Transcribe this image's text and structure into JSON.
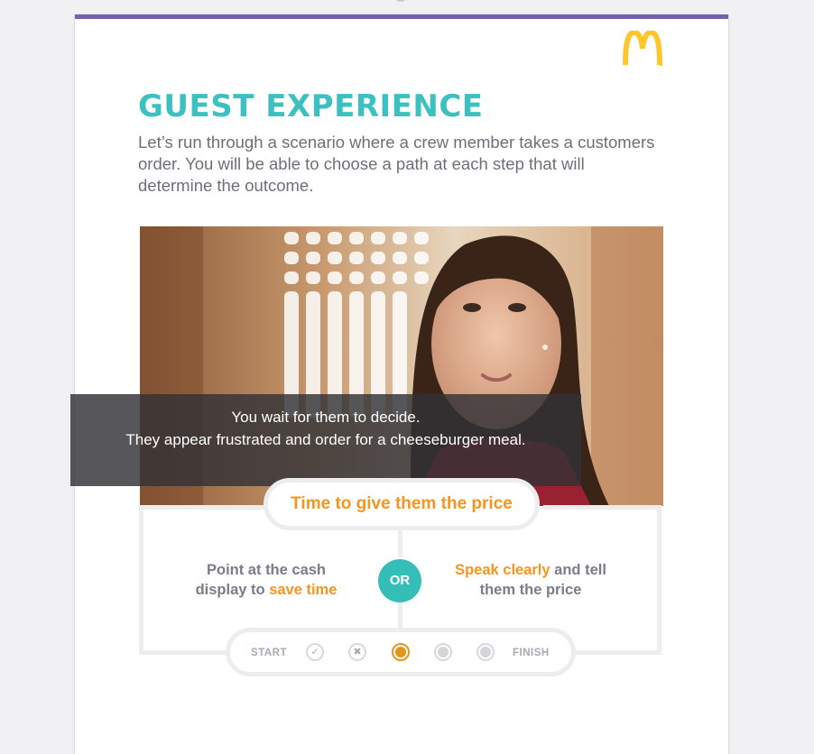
{
  "header": {
    "title": "GUEST EXPERIENCE",
    "intro": "Let’s run through a scenario where a crew member takes a customers order. You will be able to choose a path at each step that will determine the outcome."
  },
  "video": {
    "caption_line1": "You wait for them to decide.",
    "caption_line2": "They appear frustrated and order for a cheeseburger meal."
  },
  "scenario": {
    "prompt": "Time to give them the price",
    "or_label": "OR",
    "left_choice": {
      "line1": "Point at the cash",
      "line2_prefix": "display to ",
      "line2_highlight": "save time"
    },
    "right_choice": {
      "line1_highlight": "Speak clearly",
      "line1_suffix": " and tell",
      "line2": "them the price"
    }
  },
  "progress": {
    "start_label": "START",
    "finish_label": "FINISH",
    "steps": [
      {
        "state": "completed",
        "icon": "check-icon"
      },
      {
        "state": "failed",
        "icon": "x-icon"
      },
      {
        "state": "current",
        "icon": "dot-icon"
      },
      {
        "state": "upcoming",
        "icon": "dot-icon"
      },
      {
        "state": "upcoming",
        "icon": "dot-icon"
      }
    ]
  },
  "colors": {
    "brand_purple": "#7460ad",
    "title_teal": "#3cc0c0",
    "accent_orange": "#f7941d",
    "or_badge_teal": "#35bdb7",
    "logo_yellow": "#ffc72c"
  }
}
